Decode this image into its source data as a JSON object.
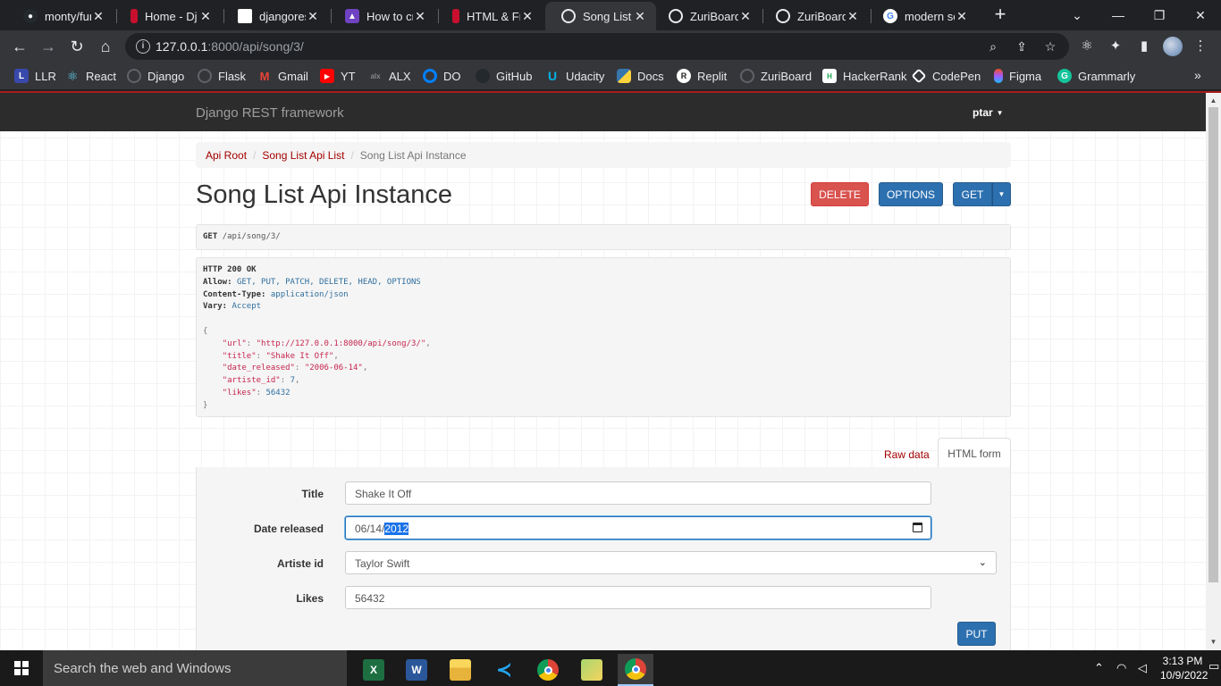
{
  "browser": {
    "tabs": [
      {
        "title": "monty/fun",
        "favicon": "github-icon",
        "color": "#24292e"
      },
      {
        "title": "Home - Dj",
        "favicon": "django-icon",
        "color": "#c8102e"
      },
      {
        "title": "djangorest",
        "favicon": "cube-icon",
        "color": "#ffffff"
      },
      {
        "title": "How to cre",
        "favicon": "bookmark-icon",
        "color": "#6f42c1"
      },
      {
        "title": "HTML & Fr",
        "favicon": "django-icon",
        "color": "#c8102e"
      },
      {
        "title": "Song List A",
        "favicon": "globe-icon",
        "color": "#e8eaed"
      },
      {
        "title": "ZuriBoard",
        "favicon": "globe-icon",
        "color": "#e8eaed"
      },
      {
        "title": "ZuriBoard",
        "favicon": "globe-icon",
        "color": "#e8eaed"
      },
      {
        "title": "modern sc",
        "favicon": "google-icon",
        "color": "#ffffff"
      }
    ],
    "active_tab": 5,
    "url_host": "127.0.0.1",
    "url_path": ":8000/api/song/3/",
    "bookmarks": [
      {
        "label": "LLR",
        "icon": "llr-icon",
        "color": "#3949ab"
      },
      {
        "label": "React",
        "icon": "react-icon",
        "color": "#61dafb"
      },
      {
        "label": "Django",
        "icon": "globe-icon",
        "color": "#5f6368"
      },
      {
        "label": "Flask",
        "icon": "globe-icon",
        "color": "#5f6368"
      },
      {
        "label": "Gmail",
        "icon": "gmail-icon",
        "color": "#ea4335"
      },
      {
        "label": "YT",
        "icon": "youtube-icon",
        "color": "#ff0000"
      },
      {
        "label": "ALX",
        "icon": "alx-icon",
        "color": "#3c3c3c"
      },
      {
        "label": "DO",
        "icon": "digitalocean-icon",
        "color": "#0080ff"
      },
      {
        "label": "GitHub",
        "icon": "github-icon",
        "color": "#24292e"
      },
      {
        "label": "Udacity",
        "icon": "udacity-icon",
        "color": "#02b3e4"
      },
      {
        "label": "Docs",
        "icon": "python-icon",
        "color": "#3776ab"
      },
      {
        "label": "Replit",
        "icon": "replit-icon",
        "color": "#ffffff"
      },
      {
        "label": "ZuriBoard",
        "icon": "globe-icon",
        "color": "#5f6368"
      },
      {
        "label": "HackerRank",
        "icon": "hackerrank-icon",
        "color": "#1ba94c"
      },
      {
        "label": "CodePen",
        "icon": "codepen-icon",
        "color": "#ffffff"
      },
      {
        "label": "Figma",
        "icon": "figma-icon",
        "color": "#f24e1e"
      },
      {
        "label": "Grammarly",
        "icon": "grammarly-icon",
        "color": "#15c39a"
      }
    ]
  },
  "drf": {
    "brand": "Django REST framework",
    "user": "ptar",
    "breadcrumb": {
      "root": "Api Root",
      "list": "Song List Api List",
      "current": "Song List Api Instance"
    },
    "heading": "Song List Api Instance",
    "buttons": {
      "delete": "DELETE",
      "options": "OPTIONS",
      "get": "GET",
      "put": "PUT"
    },
    "request": {
      "method": "GET",
      "path": "/api/song/3/"
    },
    "response": {
      "status": "HTTP 200 OK",
      "allow_key": "Allow:",
      "allow_value": "GET, PUT, PATCH, DELETE, HEAD, OPTIONS",
      "ctype_key": "Content-Type:",
      "ctype_value": "application/json",
      "vary_key": "Vary:",
      "vary_value": "Accept",
      "json": {
        "url": "http://127.0.0.1:8000/api/song/3/",
        "title": "Shake It Off",
        "date_released": "2006-06-14",
        "artiste_id": "7",
        "likes": "56432"
      }
    },
    "tabs": {
      "raw": "Raw data",
      "html": "HTML form"
    },
    "form": {
      "title_label": "Title",
      "title_value": "Shake It Off",
      "date_label": "Date released",
      "date_prefix": "06/14/",
      "date_year": "2012",
      "artiste_label": "Artiste id",
      "artiste_value": "Taylor Swift",
      "likes_label": "Likes",
      "likes_value": "56432"
    },
    "colors": {
      "navbar": "#2c2c2c",
      "link": "#a30000",
      "primary": "#2c70b0",
      "danger": "#d9534f"
    }
  },
  "taskbar": {
    "search_placeholder": "Search the web and Windows",
    "apps": [
      "excel-icon",
      "word-icon",
      "file-explorer-icon",
      "vscode-icon",
      "chrome-icon",
      "folder-icon",
      "chrome-profile-icon"
    ],
    "time": "3:13 PM",
    "date": "10/9/2022"
  }
}
